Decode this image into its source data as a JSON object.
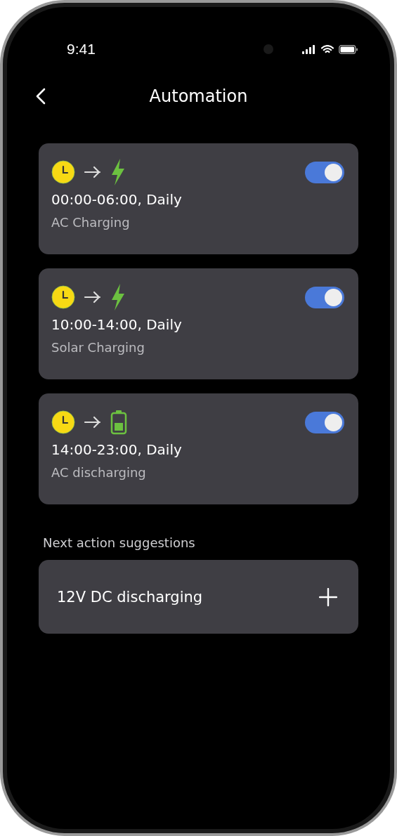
{
  "status_bar": {
    "time": "9:41"
  },
  "header": {
    "title": "Automation"
  },
  "automations": [
    {
      "kind": "bolt",
      "schedule": "00:00-06:00, Daily",
      "mode": "AC Charging",
      "on": true
    },
    {
      "kind": "bolt",
      "schedule": "10:00-14:00, Daily",
      "mode": "Solar Charging",
      "on": true
    },
    {
      "kind": "battery",
      "schedule": "14:00-23:00, Daily",
      "mode": "AC discharging",
      "on": true
    }
  ],
  "suggestions": {
    "heading": "Next action suggestions",
    "items": [
      {
        "label": "12V DC discharging"
      }
    ]
  }
}
